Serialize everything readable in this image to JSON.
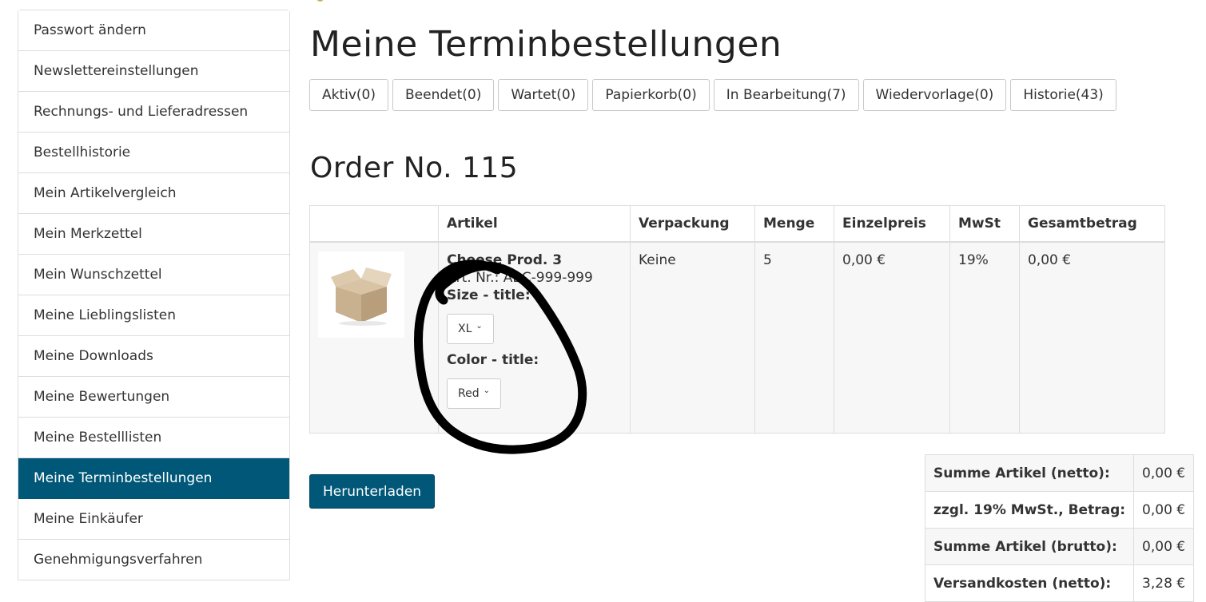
{
  "sidebar": {
    "items": [
      {
        "label": "Passwort ändern"
      },
      {
        "label": "Newslettereinstellungen"
      },
      {
        "label": "Rechnungs- und Lieferadressen"
      },
      {
        "label": "Bestellhistorie"
      },
      {
        "label": "Mein Artikelvergleich"
      },
      {
        "label": "Mein Merkzettel"
      },
      {
        "label": "Mein Wunschzettel"
      },
      {
        "label": "Meine Lieblingslisten"
      },
      {
        "label": "Meine Downloads"
      },
      {
        "label": "Meine Bewertungen"
      },
      {
        "label": "Meine Bestelllisten"
      },
      {
        "label": "Meine Terminbestellungen",
        "active": true
      },
      {
        "label": "Meine Einkäufer"
      },
      {
        "label": "Genehmigungsverfahren"
      }
    ]
  },
  "main": {
    "title": "Meine Terminbestellungen",
    "tabs": [
      {
        "label": "Aktiv(0)"
      },
      {
        "label": "Beendet(0)"
      },
      {
        "label": "Wartet(0)"
      },
      {
        "label": "Papierkorb(0)"
      },
      {
        "label": "In Bearbeitung(7)"
      },
      {
        "label": "Wiedervorlage(0)"
      },
      {
        "label": "Historie(43)"
      }
    ],
    "order_title": "Order No. 115",
    "table": {
      "headers": [
        "",
        "Artikel",
        "Verpackung",
        "Menge",
        "Einzelpreis",
        "MwSt",
        "Gesamtbetrag"
      ],
      "row": {
        "image_icon": "cardboard-box-icon",
        "product_name": "Cheese Prod. 3",
        "art_nr": "Art. Nr.: ABC-999-999",
        "size_label": "Size - title:",
        "size_value": "XL",
        "color_label": "Color - title:",
        "color_value": "Red",
        "verpackung": "Keine",
        "menge": "5",
        "einzelpreis": "0,00 €",
        "mwst": "19%",
        "gesamtbetrag": "0,00 €"
      }
    },
    "download_label": "Herunterladen",
    "summary": [
      {
        "label": "Summe Artikel (netto):",
        "value": "0,00 €"
      },
      {
        "label": "zzgl. 19% MwSt., Betrag:",
        "value": "0,00 €"
      },
      {
        "label": "Summe Artikel (brutto):",
        "value": "0,00 €"
      },
      {
        "label": "Versandkosten (netto):",
        "value": "3,28 €"
      }
    ]
  },
  "colors": {
    "accent": "#005778",
    "border": "#dddddd",
    "row_bg": "#f7f7f7",
    "annotation": "#000000"
  }
}
